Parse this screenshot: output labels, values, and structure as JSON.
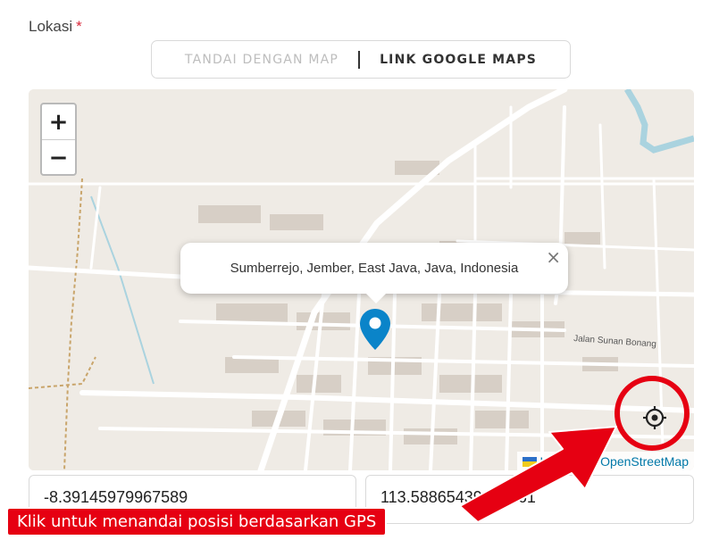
{
  "field": {
    "label": "Lokasi",
    "required_mark": "*"
  },
  "mode_toggle": {
    "option_map": "TANDAI DENGAN MAP",
    "option_link": "LINK GOOGLE MAPS"
  },
  "map": {
    "zoom_in": "+",
    "zoom_out": "−",
    "popup_text": "Sumberrejo, Jember, East Java, Java, Indonesia",
    "popup_close": "×",
    "street_label": "Jalan Sunan Bonang",
    "attribution": "Leaflet | © OpenStreetMap",
    "marker_color": "#0a84c9",
    "gps_icon": "crosshair-icon"
  },
  "coordinates": {
    "latitude": "-8.39145979967589",
    "longitude": "113.58865439496461"
  },
  "annotation": {
    "text": "Klik untuk menandai posisi berdasarkan GPS",
    "color": "#e60012"
  }
}
